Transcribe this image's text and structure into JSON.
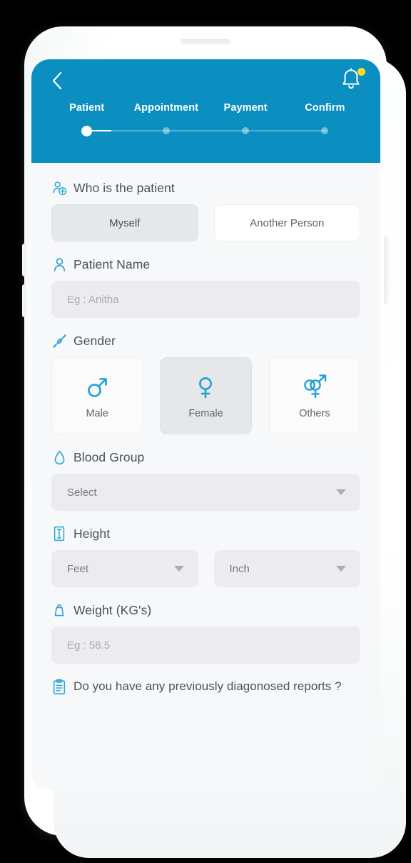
{
  "header": {
    "back_icon": "chevron-left-icon",
    "bell_icon": "bell-icon",
    "bell_badge": true,
    "background_color": "#0b8fc0",
    "steps": [
      {
        "label": "Patient",
        "active": true
      },
      {
        "label": "Appointment",
        "active": false
      },
      {
        "label": "Payment",
        "active": false
      },
      {
        "label": "Confirm",
        "active": false
      }
    ]
  },
  "form": {
    "who_is_patient": {
      "icon": "person-add-icon",
      "label": "Who is the patient",
      "options": [
        {
          "label": "Myself",
          "selected": true
        },
        {
          "label": "Another Person",
          "selected": false
        }
      ]
    },
    "patient_name": {
      "icon": "person-icon",
      "label": "Patient Name",
      "value": "",
      "placeholder": "Eg : Anitha"
    },
    "gender": {
      "icon": "gender-icon",
      "label": "Gender",
      "options": [
        {
          "label": "Male",
          "icon": "male-symbol-icon",
          "selected": false
        },
        {
          "label": "Female",
          "icon": "female-symbol-icon",
          "selected": true
        },
        {
          "label": "Others",
          "icon": "transgender-symbol-icon",
          "selected": false
        }
      ]
    },
    "blood_group": {
      "icon": "blood-drop-icon",
      "label": "Blood Group",
      "value": "Select"
    },
    "height": {
      "icon": "height-ruler-icon",
      "label": "Height",
      "feet_value": "Feet",
      "inch_value": "Inch"
    },
    "weight": {
      "icon": "weight-icon",
      "label": "Weight (KG's)",
      "value": "",
      "placeholder": "Eg : 58.5"
    },
    "reports_question": {
      "icon": "clipboard-report-icon",
      "label": "Do you have any previously diagonosed reports ?"
    }
  },
  "colors": {
    "accent": "#0b8fc0",
    "icon_blue": "#2ba6d9",
    "screen_bg": "#f7f8f9",
    "input_bg": "#ececee",
    "badge_yellow": "#ffdd28"
  }
}
